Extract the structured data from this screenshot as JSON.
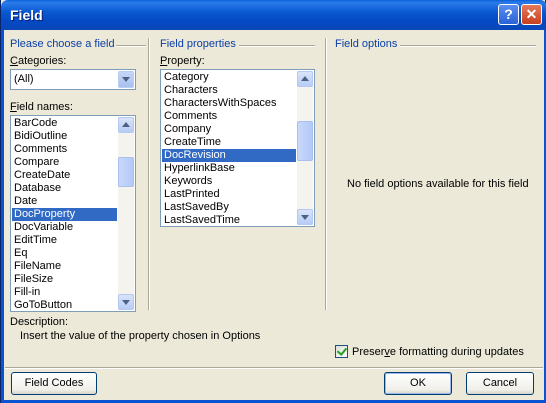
{
  "window": {
    "title": "Field",
    "help_glyph": "?",
    "close_glyph": "✕"
  },
  "choose": {
    "title": "Please choose a field",
    "categories_label_u": "C",
    "categories_label_rest": "ategories:",
    "categories_value": "(All)",
    "field_names_label_u": "F",
    "field_names_label_rest": "ield names:",
    "field_names": [
      "BarCode",
      "BidiOutline",
      "Comments",
      "Compare",
      "CreateDate",
      "Database",
      "Date",
      "DocProperty",
      "DocVariable",
      "EditTime",
      "Eq",
      "FileName",
      "FileSize",
      "Fill-in",
      "GoToButton"
    ],
    "selected_field": "DocProperty"
  },
  "properties": {
    "title": "Field properties",
    "property_label_u": "P",
    "property_label_rest": "roperty:",
    "items": [
      "Category",
      "Characters",
      "CharactersWithSpaces",
      "Comments",
      "Company",
      "CreateTime",
      "DocRevision",
      "HyperlinkBase",
      "Keywords",
      "LastPrinted",
      "LastSavedBy",
      "LastSavedTime"
    ],
    "selected": "DocRevision"
  },
  "options": {
    "title": "Field options",
    "empty_message": "No field options available for this field",
    "preserve_label_pre": "Preser",
    "preserve_label_u": "v",
    "preserve_label_post": "e formatting during updates",
    "preserve_checked": true
  },
  "description": {
    "label": "Description:",
    "text": "Insert the value of the property chosen in Options"
  },
  "buttons": {
    "field_codes": "Field Codes",
    "ok": "OK",
    "cancel": "Cancel"
  },
  "colors": {
    "accent": "#0a3fa8",
    "selection": "#316ac5",
    "face": "#ece9d8"
  }
}
